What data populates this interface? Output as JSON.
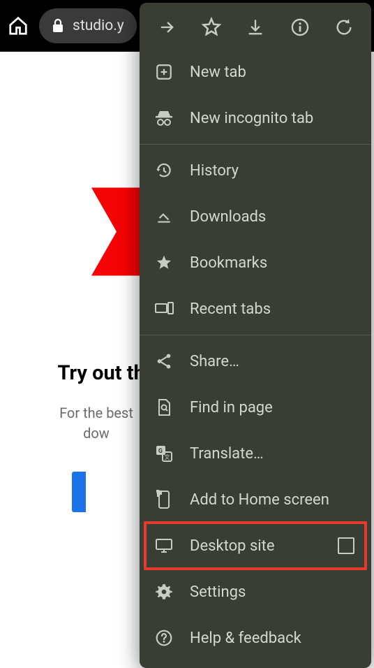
{
  "toolbar": {
    "url": "studio.yo"
  },
  "page": {
    "heading": "Try out the",
    "subtext_line1": "For the best",
    "subtext_line2": "dow"
  },
  "menu": {
    "new_tab": "New tab",
    "new_incognito": "New incognito tab",
    "history": "History",
    "downloads": "Downloads",
    "bookmarks": "Bookmarks",
    "recent_tabs": "Recent tabs",
    "share": "Share…",
    "find_in_page": "Find in page",
    "translate": "Translate…",
    "add_to_home": "Add to Home screen",
    "desktop_site": "Desktop site",
    "settings": "Settings",
    "help_feedback": "Help & feedback"
  }
}
